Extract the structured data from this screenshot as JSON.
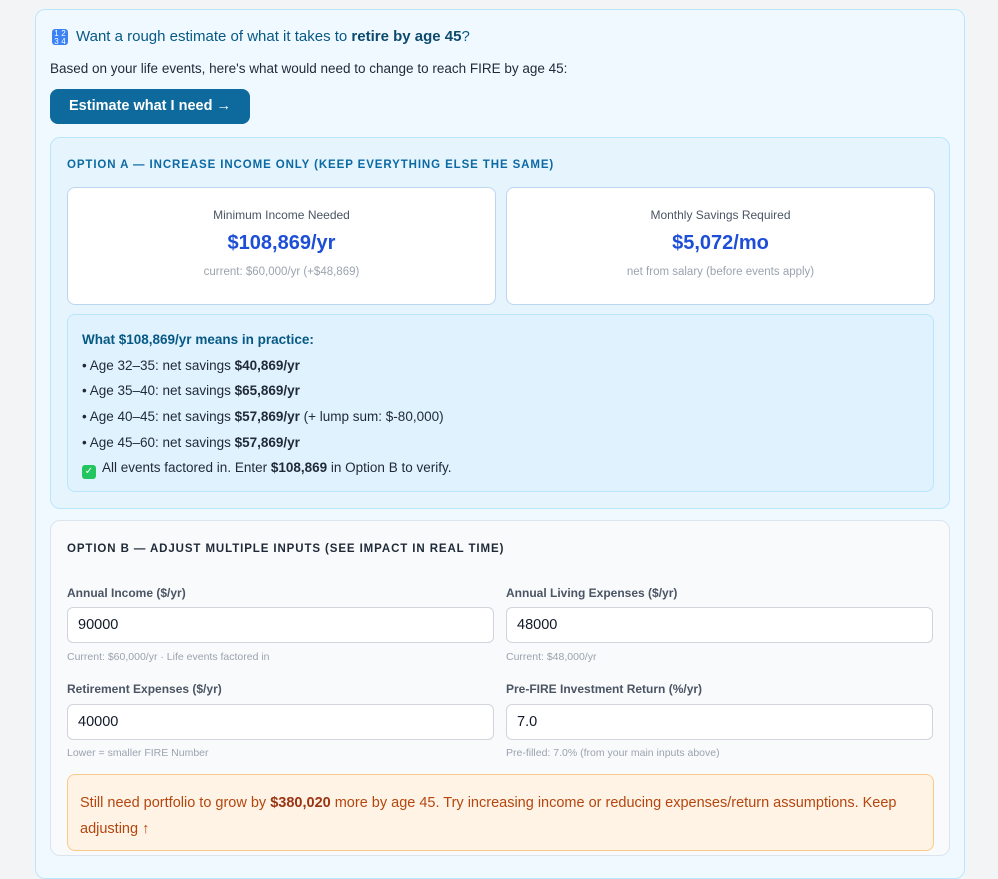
{
  "header": {
    "icon": "calculator-icon",
    "question_prefix": "Want a rough estimate of what it takes to ",
    "question_bold": "retire by age 45",
    "question_suffix": "?",
    "subtext": "Based on your life events, here's what would need to change to reach FIRE by age 45:",
    "cta_label": "Estimate what I need →"
  },
  "option_a": {
    "title": "Option A — Increase income only (keep everything else the same)",
    "cards": [
      {
        "label": "Minimum Income Needed",
        "value": "$108,869/yr",
        "note": "current: $60,000/yr (+$48,869)"
      },
      {
        "label": "Monthly Savings Required",
        "value": "$5,072/mo",
        "note": "net from salary (before events apply)"
      }
    ],
    "practice": {
      "title": "What $108,869/yr means in practice:",
      "lines": [
        {
          "prefix": "• Age 32–35: net savings ",
          "bold": "$40,869/yr",
          "suffix": ""
        },
        {
          "prefix": "• Age 35–40: net savings ",
          "bold": "$65,869/yr",
          "suffix": ""
        },
        {
          "prefix": "• Age 40–45: net savings ",
          "bold": "$57,869/yr",
          "suffix": " (+ lump sum: $-80,000)"
        },
        {
          "prefix": "• Age 45–60: net savings ",
          "bold": "$57,869/yr",
          "suffix": ""
        }
      ],
      "verify_prefix": "All events factored in. Enter ",
      "verify_bold": "$108,869",
      "verify_suffix": " in Option B to verify."
    }
  },
  "option_b": {
    "title": "Option B — Adjust multiple inputs (see impact in real time)",
    "fields": [
      {
        "label": "Annual Income ($/yr)",
        "value": "90000",
        "hint": "Current: $60,000/yr · Life events factored in"
      },
      {
        "label": "Annual Living Expenses ($/yr)",
        "value": "48000",
        "hint": "Current: $48,000/yr"
      },
      {
        "label": "Retirement Expenses ($/yr)",
        "value": "40000",
        "hint": "Lower = smaller FIRE Number"
      },
      {
        "label": "Pre-FIRE Investment Return (%/yr)",
        "value": "7.0",
        "hint": "Pre-filled: 7.0% (from your main inputs above)"
      }
    ],
    "warning": {
      "prefix": "Still need portfolio to grow by ",
      "bold": "$380,020",
      "suffix": " more by age 45. Try increasing income or reducing expenses/return assumptions. Keep adjusting ↑"
    }
  }
}
